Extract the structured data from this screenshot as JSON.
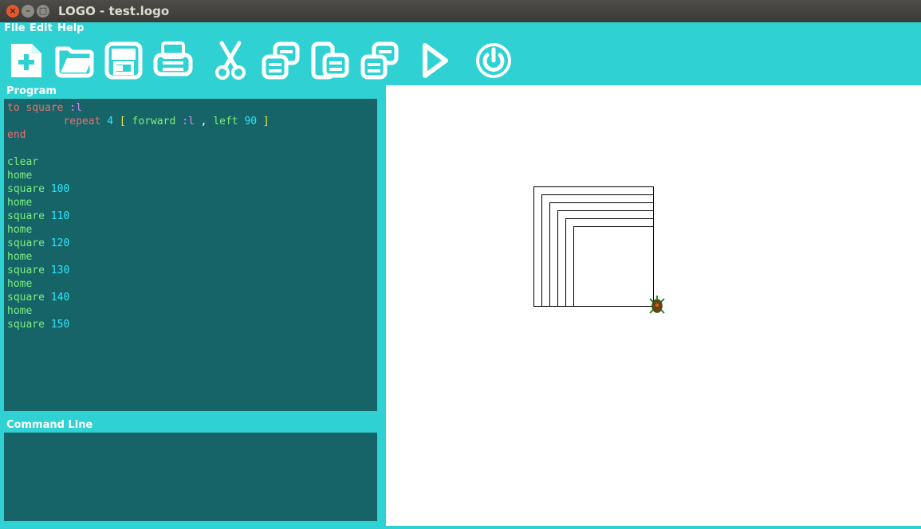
{
  "window": {
    "title": "LOGO - test.logo"
  },
  "menu": {
    "file": "File",
    "edit": "Edit",
    "help": "Help"
  },
  "toolbar": {
    "icons": [
      "new-file-icon",
      "open-folder-icon",
      "save-icon",
      "print-icon",
      "cut-icon",
      "copy-icon",
      "paste-icon",
      "duplicate-icon",
      "run-icon",
      "power-icon"
    ]
  },
  "panels": {
    "program_label": "Program",
    "command_label": "Command Line",
    "command_value": ""
  },
  "program": {
    "lines": [
      [
        {
          "t": "to square ",
          "c": "kw-red"
        },
        {
          "t": ":l",
          "c": "param"
        }
      ],
      [
        {
          "t": "         repeat ",
          "c": "kw-red"
        },
        {
          "t": "4 ",
          "c": "num"
        },
        {
          "t": "[ ",
          "c": "bracket"
        },
        {
          "t": "forward ",
          "c": "kw-green"
        },
        {
          "t": ":l",
          "c": "param"
        },
        {
          "t": " , ",
          "c": "plain"
        },
        {
          "t": "left ",
          "c": "kw-green"
        },
        {
          "t": "90",
          "c": "num"
        },
        {
          "t": " ]",
          "c": "bracket"
        }
      ],
      [
        {
          "t": "end",
          "c": "kw-red"
        }
      ],
      [],
      [
        {
          "t": "clear",
          "c": "kw-green"
        }
      ],
      [
        {
          "t": "home",
          "c": "kw-green"
        }
      ],
      [
        {
          "t": "square ",
          "c": "kw-green"
        },
        {
          "t": "100",
          "c": "num"
        }
      ],
      [
        {
          "t": "home",
          "c": "kw-green"
        }
      ],
      [
        {
          "t": "square ",
          "c": "kw-green"
        },
        {
          "t": "110",
          "c": "num"
        }
      ],
      [
        {
          "t": "home",
          "c": "kw-green"
        }
      ],
      [
        {
          "t": "square ",
          "c": "kw-green"
        },
        {
          "t": "120",
          "c": "num"
        }
      ],
      [
        {
          "t": "home",
          "c": "kw-green"
        }
      ],
      [
        {
          "t": "square ",
          "c": "kw-green"
        },
        {
          "t": "130",
          "c": "num"
        }
      ],
      [
        {
          "t": "home",
          "c": "kw-green"
        }
      ],
      [
        {
          "t": "square ",
          "c": "kw-green"
        },
        {
          "t": "140",
          "c": "num"
        }
      ],
      [
        {
          "t": "home",
          "c": "kw-green"
        }
      ],
      [
        {
          "t": "square ",
          "c": "kw-green"
        },
        {
          "t": "150",
          "c": "num"
        }
      ]
    ]
  },
  "drawing": {
    "square_sides": [
      100,
      110,
      120,
      130,
      140,
      150
    ],
    "turtle": "turtle-icon"
  },
  "colors": {
    "accent": "#2fd1d3",
    "editor_bg": "#166467",
    "keyword_red": "#f26e6e",
    "keyword_green": "#7cf07c",
    "number": "#2fe6ff",
    "parameter": "#e087ff",
    "bracket": "#f0e43c"
  }
}
